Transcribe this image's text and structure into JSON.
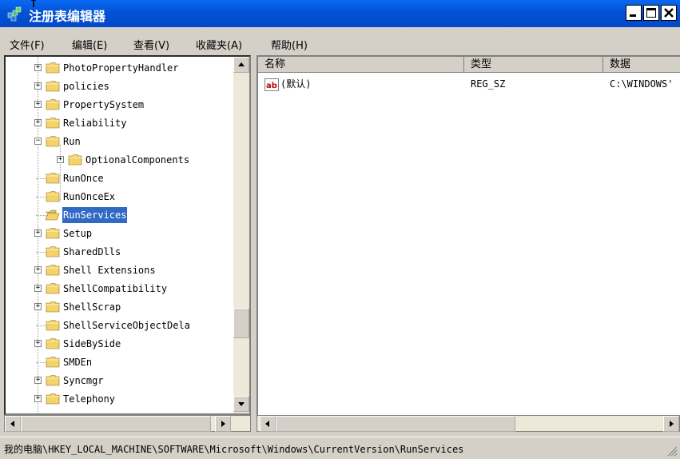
{
  "window": {
    "title": "注册表编辑器"
  },
  "menu": [
    "文件(F)",
    "编辑(E)",
    "查看(V)",
    "收藏夹(A)",
    "帮助(H)"
  ],
  "tree": {
    "nodes": [
      {
        "label": "PhotoPropertyHandler",
        "expander": "+"
      },
      {
        "label": "policies",
        "expander": "+"
      },
      {
        "label": "PropertySystem",
        "expander": "+"
      },
      {
        "label": "Reliability",
        "expander": "+"
      },
      {
        "label": "Run",
        "expander": "-"
      },
      {
        "label": "OptionalComponents",
        "expander": "+"
      },
      {
        "label": "RunOnce",
        "expander": ""
      },
      {
        "label": "RunOnceEx",
        "expander": ""
      },
      {
        "label": "RunServices",
        "expander": "",
        "selected": true
      },
      {
        "label": "Setup",
        "expander": "+"
      },
      {
        "label": "SharedDlls",
        "expander": ""
      },
      {
        "label": "Shell Extensions",
        "expander": "+"
      },
      {
        "label": "ShellCompatibility",
        "expander": "+"
      },
      {
        "label": "ShellScrap",
        "expander": "+"
      },
      {
        "label": "ShellServiceObjectDela",
        "expander": ""
      },
      {
        "label": "SideBySide",
        "expander": "+"
      },
      {
        "label": "SMDEn",
        "expander": ""
      },
      {
        "label": "Syncmgr",
        "expander": "+"
      },
      {
        "label": "Telephony",
        "expander": "+"
      }
    ]
  },
  "list": {
    "columns": [
      "名称",
      "类型",
      "数据"
    ],
    "rows": [
      {
        "name": "(默认)",
        "type": "REG_SZ",
        "data": "C:\\WINDOWS'"
      }
    ]
  },
  "status": "我的电脑\\HKEY_LOCAL_MACHINE\\SOFTWARE\\Microsoft\\Windows\\CurrentVersion\\RunServices",
  "colors": {
    "titlebar": "#0352d6",
    "selection": "#316ac5",
    "folder": "#f5d36b"
  },
  "icons": [
    "regedit-icon",
    "folder-icon",
    "string-value-icon"
  ]
}
